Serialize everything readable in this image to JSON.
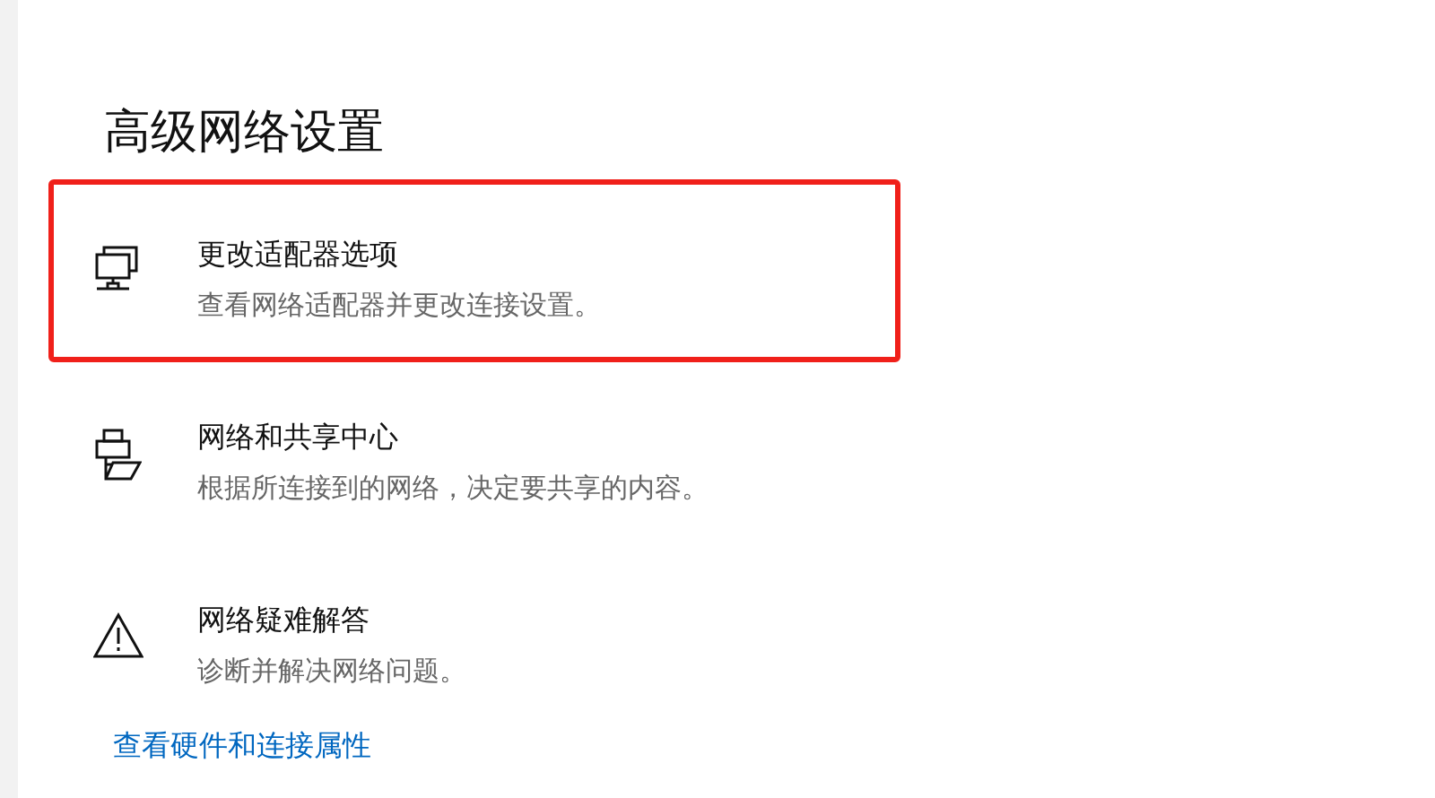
{
  "title": "高级网络设置",
  "items": [
    {
      "kind": "adapter",
      "title": "更改适配器选项",
      "description": "查看网络适配器并更改连接设置。",
      "highlighted": true
    },
    {
      "kind": "sharing",
      "title": "网络和共享中心",
      "description": "根据所连接到的网络，决定要共享的内容。",
      "highlighted": false
    },
    {
      "kind": "warning",
      "title": "网络疑难解答",
      "description": "诊断并解决网络问题。",
      "highlighted": false
    }
  ],
  "link": "查看硬件和连接属性"
}
